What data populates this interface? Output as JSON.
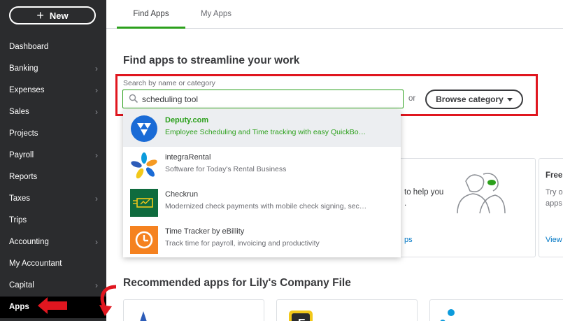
{
  "sidebar": {
    "new_label": "New",
    "items": [
      {
        "label": "Dashboard",
        "chevron": false
      },
      {
        "label": "Banking",
        "chevron": true
      },
      {
        "label": "Expenses",
        "chevron": true
      },
      {
        "label": "Sales",
        "chevron": true
      },
      {
        "label": "Projects",
        "chevron": false
      },
      {
        "label": "Payroll",
        "chevron": true
      },
      {
        "label": "Reports",
        "chevron": false
      },
      {
        "label": "Taxes",
        "chevron": true
      },
      {
        "label": "Trips",
        "chevron": false
      },
      {
        "label": "Accounting",
        "chevron": true
      },
      {
        "label": "My Accountant",
        "chevron": false
      },
      {
        "label": "Capital",
        "chevron": true
      },
      {
        "label": "Apps",
        "chevron": false,
        "active": true
      }
    ]
  },
  "tabs": {
    "find_apps": "Find Apps",
    "my_apps": "My Apps"
  },
  "main": {
    "title": "Find apps to streamline your work",
    "search_label": "Search by name or category",
    "search_value": "scheduling tool",
    "or_text": "or",
    "browse_label": "Browse category"
  },
  "background_card": {
    "text1": "to help you",
    "text2": ".",
    "link": "ps"
  },
  "right_card": {
    "title": "Free",
    "line1": "Try o",
    "line2": "apps",
    "link": "View"
  },
  "dropdown": [
    {
      "name": "Deputy.com",
      "desc": "Employee Scheduling and Time tracking with easy QuickBo…",
      "icon": "deputy-logo"
    },
    {
      "name": "integraRental",
      "desc": "Software for Today's Rental Business",
      "icon": "integrarental-logo"
    },
    {
      "name": "Checkrun",
      "desc": "Modernized check payments with mobile check signing, sec…",
      "icon": "checkrun-logo"
    },
    {
      "name": "Time Tracker by eBillity",
      "desc": "Track time for payroll, invoicing and productivity",
      "icon": "ebillity-logo"
    }
  ],
  "recommended": {
    "title": "Recommended apps for Lily's Company File"
  },
  "colors": {
    "accent": "#2ca01c",
    "annotation": "#e0161f",
    "sidebar": "#2b2c2e"
  }
}
